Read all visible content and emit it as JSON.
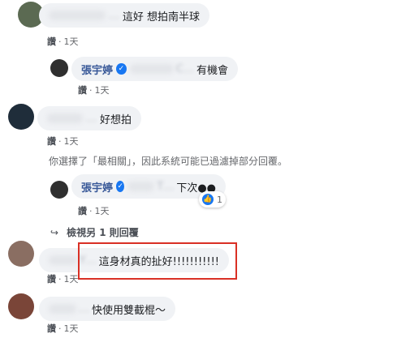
{
  "comments": [
    {
      "author_obscured": "…",
      "text": "這好 想拍南半球",
      "like_label": "讚",
      "time": "1天"
    },
    {
      "author_obscured": "…",
      "text": "好想拍",
      "like_label": "讚",
      "time": "1天"
    },
    {
      "author_obscured": "Y…",
      "text": "這身材真的扯好!!!!!!!!!!!",
      "like_label": "讚",
      "time": "1天"
    },
    {
      "author_obscured": "…",
      "text": "快使用雙截棍～",
      "like_label": "讚",
      "time": "1天"
    }
  ],
  "replies": [
    {
      "author": "張宇婷",
      "verified_icon": "check-icon",
      "mention_obscured": "C…",
      "text": "有機會",
      "like_label": "讚",
      "time": "1天"
    },
    {
      "author": "張宇婷",
      "verified_icon": "check-icon",
      "mention_obscured": "T…",
      "text": "下次●●",
      "like_label": "讚",
      "time": "1天",
      "reaction": {
        "icon": "thumbs-up-icon",
        "count": "1"
      }
    }
  ],
  "filter_notice": "你選擇了「最相關」，因此系統可能已過濾掉部分回覆。",
  "view_more_replies": "檢視另 1 則回覆",
  "colors": {
    "link": "#385898",
    "bubble": "#f0f2f5",
    "highlight": "#d93025",
    "badge": "#1877f2"
  }
}
